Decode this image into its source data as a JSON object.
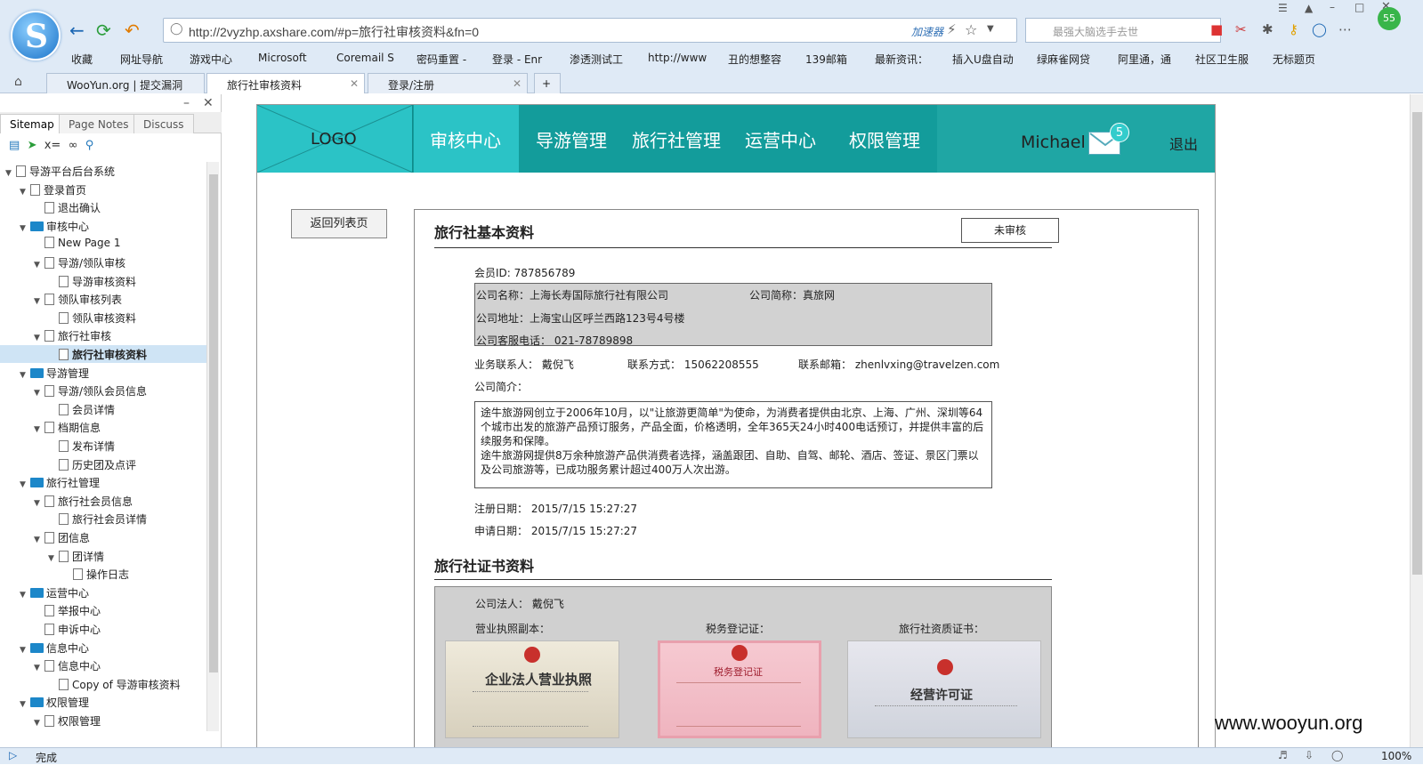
{
  "browser": {
    "url": "http://2vyzhp.axshare.com/#p=旅行社审核资料&fn=0",
    "accelerator_label": "加速器",
    "search_placeholder": "最强大脑选手去世",
    "bookmarks": [
      "收藏",
      "网址导航",
      "游戏中心",
      "Microsoft",
      "Coremail S",
      "密码重置 -",
      "登录 - Enr",
      "渗透测试工",
      "http://www",
      "丑的想整容",
      "139邮箱",
      "最新资讯：",
      "插入U盘自动",
      "绿麻雀网贷",
      "阿里通，通",
      "社区卫生服",
      "无标题页"
    ],
    "tabs": [
      "WooYun.org | 提交漏洞",
      "旅行社审核资料",
      "登录/注册"
    ],
    "status_text": "完成",
    "zoom": "100%",
    "badge": "55"
  },
  "sidebar": {
    "tabs": [
      "Sitemap",
      "Page Notes",
      "Discuss"
    ],
    "tree": [
      {
        "label": "导游平台后台系统",
        "level": 0,
        "type": "page",
        "open": true
      },
      {
        "label": "登录首页",
        "level": 1,
        "type": "page",
        "open": true
      },
      {
        "label": "退出确认",
        "level": 2,
        "type": "page"
      },
      {
        "label": "审核中心",
        "level": 1,
        "type": "folder",
        "open": true
      },
      {
        "label": "New Page 1",
        "level": 2,
        "type": "page"
      },
      {
        "label": "导游/领队审核",
        "level": 2,
        "type": "page",
        "open": true
      },
      {
        "label": "导游审核资料",
        "level": 3,
        "type": "page"
      },
      {
        "label": "领队审核列表",
        "level": 2,
        "type": "page",
        "open": true
      },
      {
        "label": "领队审核资料",
        "level": 3,
        "type": "page"
      },
      {
        "label": "旅行社审核",
        "level": 2,
        "type": "page",
        "open": true
      },
      {
        "label": "旅行社审核资料",
        "level": 3,
        "type": "page",
        "selected": true
      },
      {
        "label": "导游管理",
        "level": 1,
        "type": "folder",
        "open": true
      },
      {
        "label": "导游/领队会员信息",
        "level": 2,
        "type": "page",
        "open": true
      },
      {
        "label": "会员详情",
        "level": 3,
        "type": "page"
      },
      {
        "label": "档期信息",
        "level": 2,
        "type": "page",
        "open": true
      },
      {
        "label": "发布详情",
        "level": 3,
        "type": "page"
      },
      {
        "label": "历史团及点评",
        "level": 3,
        "type": "page"
      },
      {
        "label": "旅行社管理",
        "level": 1,
        "type": "folder",
        "open": true
      },
      {
        "label": "旅行社会员信息",
        "level": 2,
        "type": "page",
        "open": true
      },
      {
        "label": "旅行社会员详情",
        "level": 3,
        "type": "page"
      },
      {
        "label": "团信息",
        "level": 2,
        "type": "page",
        "open": true
      },
      {
        "label": "团详情",
        "level": 3,
        "type": "page",
        "open": true
      },
      {
        "label": "操作日志",
        "level": 4,
        "type": "page"
      },
      {
        "label": "运营中心",
        "level": 1,
        "type": "folder",
        "open": true
      },
      {
        "label": "举报中心",
        "level": 2,
        "type": "page"
      },
      {
        "label": "申诉中心",
        "level": 2,
        "type": "page"
      },
      {
        "label": "信息中心",
        "level": 1,
        "type": "folder",
        "open": true
      },
      {
        "label": "信息中心",
        "level": 2,
        "type": "page",
        "open": true
      },
      {
        "label": "Copy of 导游审核资料",
        "level": 3,
        "type": "page"
      },
      {
        "label": "权限管理",
        "level": 1,
        "type": "folder",
        "open": true
      },
      {
        "label": "权限管理",
        "level": 2,
        "type": "page",
        "open": true
      }
    ]
  },
  "app": {
    "logo": "LOGO",
    "nav": [
      "审核中心",
      "导游管理",
      "旅行社管理",
      "运营中心",
      "权限管理"
    ],
    "user": "Michael",
    "mail_count": "5",
    "logout": "退出",
    "back_button": "返回列表页",
    "basic_title": "旅行社基本资料",
    "status_button": "未审核",
    "member_id": "会员ID: 787856789",
    "company_name": "公司名称：上海长寿国际旅行社有限公司",
    "company_short": "公司简称：真旅网",
    "company_address": "公司地址：上海宝山区呼兰西路123号4号楼",
    "company_phone": "公司客服电话：  021-78789898",
    "contact_person": "业务联系人：  戴倪飞",
    "contact_phone": "联系方式：  15062208555",
    "contact_email": "联系邮箱：  zhenlvxing@travelzen.com",
    "intro_label": "公司简介：",
    "intro_text": "途牛旅游网创立于2006年10月，以\"让旅游更简单\"为使命，为消费者提供由北京、上海、广州、深圳等64个城市出发的旅游产品预订服务，产品全面，价格透明，全年365天24小时400电话预订，并提供丰富的后续服务和保障。\n途牛旅游网提供8万余种旅游产品供消费者选择，涵盖跟团、自助、自驾、邮轮、酒店、签证、景区门票以及公司旅游等，已成功服务累计超过400万人次出游。",
    "reg_date": "注册日期：    2015/7/15   15:27:27",
    "apply_date": "申请日期：    2015/7/15   15:27:27",
    "cert_title": "旅行社证书资料",
    "legal_person": "公司法人：  戴倪飞",
    "cert_labels": [
      "营业执照副本：",
      "税务登记证：",
      "旅行社资质证书："
    ],
    "cert_titles": [
      "企业法人营业执照",
      "税务登记证",
      "经营许可证"
    ]
  },
  "watermark": "www.wooyun.org"
}
